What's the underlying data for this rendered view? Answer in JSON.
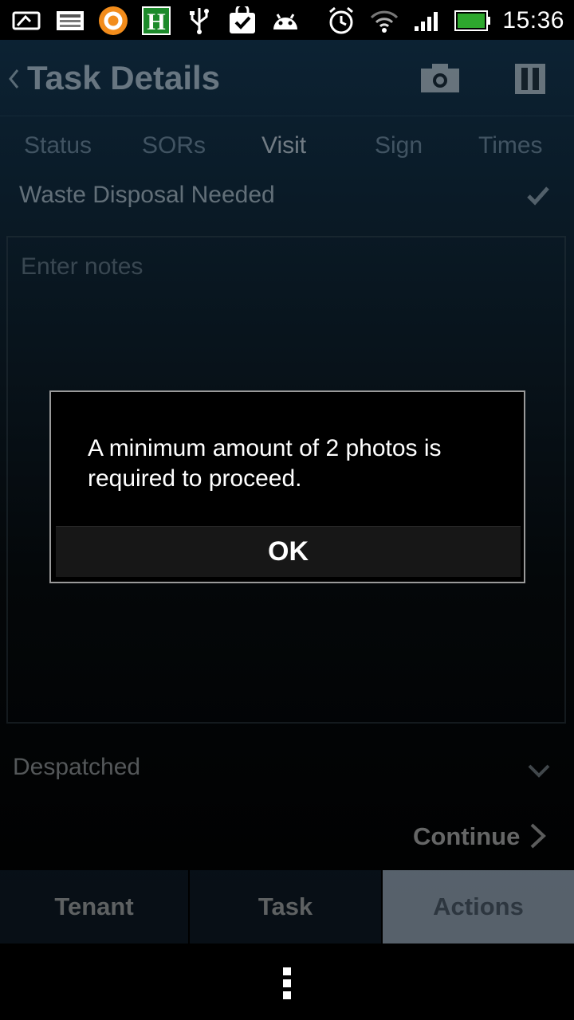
{
  "status_bar": {
    "time": "15:36",
    "icons_left": [
      "gallery-icon",
      "news-icon",
      "orange-app-icon",
      "h-app-icon",
      "usb-icon",
      "task-bag-icon",
      "android-icon"
    ],
    "icons_right": [
      "alarm-icon",
      "wifi-icon",
      "signal-icon",
      "battery-icon"
    ],
    "battery_color": "#2ea82e"
  },
  "action_bar": {
    "title": "Task Details"
  },
  "tabs": [
    {
      "label": "Status"
    },
    {
      "label": "SORs"
    },
    {
      "label": "Visit"
    },
    {
      "label": "Sign"
    },
    {
      "label": "Times"
    }
  ],
  "active_tab": "Visit",
  "waste_disposal": {
    "label": "Waste Disposal Needed"
  },
  "notes": {
    "placeholder": "Enter notes",
    "value": ""
  },
  "status_select": {
    "value": "Despatched"
  },
  "continue": {
    "label": "Continue"
  },
  "bottom_tabs": [
    {
      "label": "Tenant"
    },
    {
      "label": "Task"
    },
    {
      "label": "Actions"
    }
  ],
  "dialog": {
    "message": "A minimum amount of 2 photos is required to proceed.",
    "ok_label": "OK"
  }
}
